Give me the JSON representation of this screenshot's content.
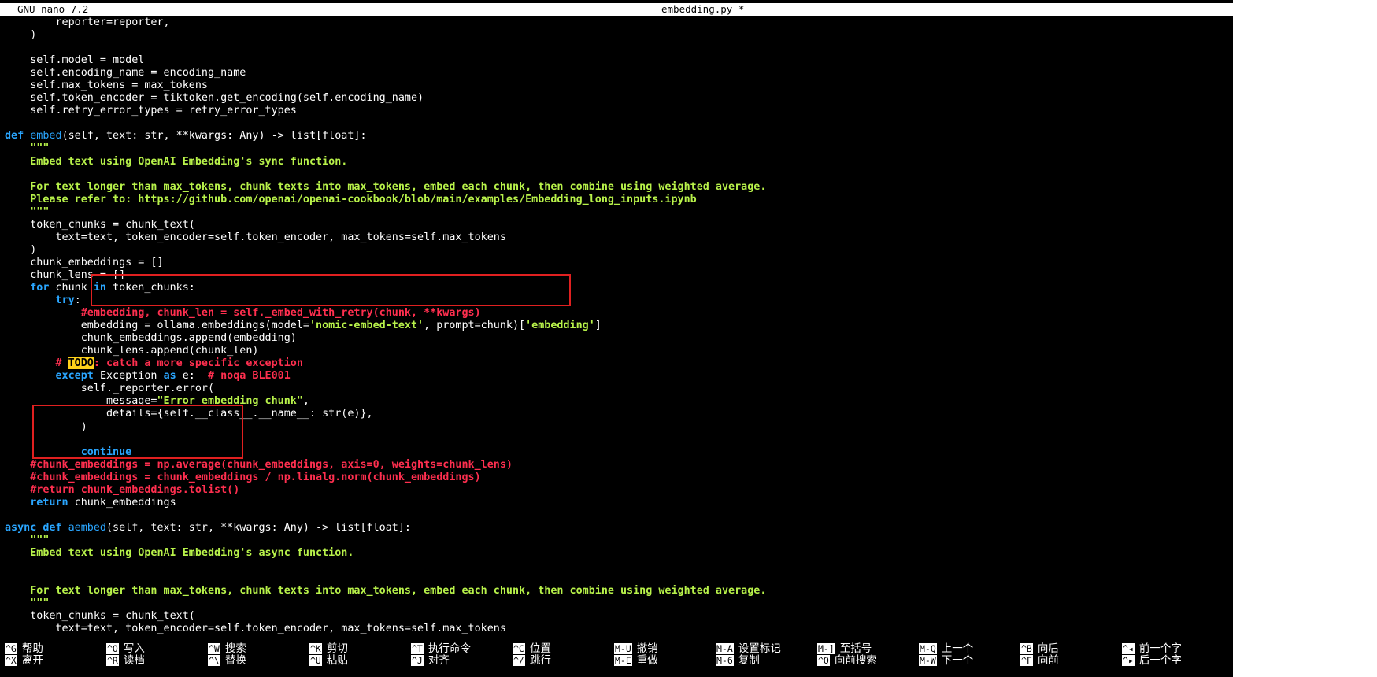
{
  "titlebar": {
    "app": "GNU nano 7.2",
    "file": "embedding.py *"
  },
  "code_lines": [
    [
      [
        "",
        "        reporter=reporter,"
      ]
    ],
    [
      [
        "",
        "    )"
      ]
    ],
    [
      [
        "",
        ""
      ]
    ],
    [
      [
        "",
        "    self.model = model"
      ]
    ],
    [
      [
        "",
        "    self.encoding_name = encoding_name"
      ]
    ],
    [
      [
        "",
        "    self.max_tokens = max_tokens"
      ]
    ],
    [
      [
        "",
        "    self.token_encoder = tiktoken.get_encoding(self.encoding_name)"
      ]
    ],
    [
      [
        "",
        "    self.retry_error_types = retry_error_types"
      ]
    ],
    [
      [
        "",
        ""
      ]
    ],
    [
      [
        "kw",
        "def "
      ],
      [
        "fn",
        "embed"
      ],
      [
        "",
        "(self, text: str, **kwargs: Any) -> list[float]:"
      ]
    ],
    [
      [
        "ds",
        "    \"\"\""
      ]
    ],
    [
      [
        "ds",
        "    Embed text using OpenAI Embedding's sync function."
      ]
    ],
    [
      [
        "",
        ""
      ]
    ],
    [
      [
        "ds",
        "    For text longer than max_tokens, chunk texts into max_tokens, embed each chunk, then combine using weighted average."
      ]
    ],
    [
      [
        "ds",
        "    Please refer to: https://github.com/openai/openai-cookbook/blob/main/examples/Embedding_long_inputs.ipynb"
      ]
    ],
    [
      [
        "ds",
        "    \"\"\""
      ]
    ],
    [
      [
        "",
        "    token_chunks = chunk_text("
      ]
    ],
    [
      [
        "",
        "        text=text, token_encoder=self.token_encoder, max_tokens=self.max_tokens"
      ]
    ],
    [
      [
        "",
        "    )"
      ]
    ],
    [
      [
        "",
        "    chunk_embeddings = []"
      ]
    ],
    [
      [
        "",
        "    chunk_lens = []"
      ]
    ],
    [
      [
        "kw",
        "    for "
      ],
      [
        "",
        "chunk "
      ],
      [
        "kw",
        "in "
      ],
      [
        "",
        "token_chunks:"
      ]
    ],
    [
      [
        "kw",
        "        try"
      ],
      [
        "",
        ":"
      ]
    ],
    [
      [
        "cm",
        "            #embedding, chunk_len = self._embed_with_retry(chunk, **kwargs)"
      ]
    ],
    [
      [
        "",
        "            embedding = ollama.embeddings(model="
      ],
      [
        "str",
        "'nomic-embed-text'"
      ],
      [
        "",
        ", prompt=chunk)["
      ],
      [
        "str",
        "'embedding'"
      ],
      [
        "",
        "]"
      ]
    ],
    [
      [
        "",
        "            chunk_embeddings.append(embedding)"
      ]
    ],
    [
      [
        "",
        "            chunk_lens.append(chunk_len)"
      ]
    ],
    [
      [
        "cm",
        "        # "
      ],
      [
        "todo",
        "TODO"
      ],
      [
        "cm",
        ": catch a more specific exception"
      ]
    ],
    [
      [
        "kw",
        "        except "
      ],
      [
        "",
        "Exception "
      ],
      [
        "kw",
        "as "
      ],
      [
        "",
        "e:  "
      ],
      [
        "cm",
        "# noqa BLE001"
      ]
    ],
    [
      [
        "",
        "            self._reporter.error("
      ]
    ],
    [
      [
        "",
        "                message="
      ],
      [
        "str",
        "\"Error embedding chunk\""
      ],
      [
        "",
        ","
      ]
    ],
    [
      [
        "",
        "                details={self.__class__.__name__: str(e)},"
      ]
    ],
    [
      [
        "",
        "            )"
      ]
    ],
    [
      [
        "",
        ""
      ]
    ],
    [
      [
        "kw",
        "            continue"
      ]
    ],
    [
      [
        "cm",
        "    #chunk_embeddings = np.average(chunk_embeddings, axis=0, weights=chunk_lens)"
      ]
    ],
    [
      [
        "cm",
        "    #chunk_embeddings = chunk_embeddings / np.linalg.norm(chunk_embeddings)"
      ]
    ],
    [
      [
        "cm",
        "    #return chunk_embeddings.tolist()"
      ]
    ],
    [
      [
        "kw",
        "    return "
      ],
      [
        "",
        "chunk_embeddings"
      ]
    ],
    [
      [
        "",
        ""
      ]
    ],
    [
      [
        "kw",
        "async def "
      ],
      [
        "fn",
        "aembed"
      ],
      [
        "",
        "(self, text: str, **kwargs: Any) -> list[float]:"
      ]
    ],
    [
      [
        "ds",
        "    \"\"\""
      ]
    ],
    [
      [
        "ds",
        "    Embed text using OpenAI Embedding's async function."
      ]
    ],
    [
      [
        "",
        ""
      ]
    ],
    [
      [
        "",
        ""
      ]
    ],
    [
      [
        "ds",
        "    For text longer than max_tokens, chunk texts into max_tokens, embed each chunk, then combine using weighted average."
      ]
    ],
    [
      [
        "ds",
        "    \"\"\""
      ]
    ],
    [
      [
        "",
        "    token_chunks = chunk_text("
      ]
    ],
    [
      [
        "",
        "        text=text, token_encoder=self.token_encoder, max_tokens=self.max_tokens"
      ]
    ]
  ],
  "shortcuts": [
    {
      "key": "^G",
      "label": "帮助"
    },
    {
      "key": "^X",
      "label": "离开"
    },
    {
      "key": "^O",
      "label": "写入"
    },
    {
      "key": "^R",
      "label": "读档"
    },
    {
      "key": "^W",
      "label": "搜索"
    },
    {
      "key": "^\\",
      "label": "替换"
    },
    {
      "key": "^K",
      "label": "剪切"
    },
    {
      "key": "^U",
      "label": "粘贴"
    },
    {
      "key": "^T",
      "label": "执行命令"
    },
    {
      "key": "^J",
      "label": "对齐"
    },
    {
      "key": "^C",
      "label": "位置"
    },
    {
      "key": "^/",
      "label": "跳行"
    },
    {
      "key": "M-U",
      "label": "撤销"
    },
    {
      "key": "M-E",
      "label": "重做"
    },
    {
      "key": "M-A",
      "label": "设置标记"
    },
    {
      "key": "M-6",
      "label": "复制"
    },
    {
      "key": "M-]",
      "label": "至括号"
    },
    {
      "key": "^Q",
      "label": "向前搜索"
    },
    {
      "key": "M-Q",
      "label": "上一个"
    },
    {
      "key": "M-W",
      "label": "下一个"
    },
    {
      "key": "^B",
      "label": "向后"
    },
    {
      "key": "^F",
      "label": "向前"
    },
    {
      "key": "^◂",
      "label": "前一个字"
    },
    {
      "key": "^▸",
      "label": "后一个字"
    }
  ]
}
